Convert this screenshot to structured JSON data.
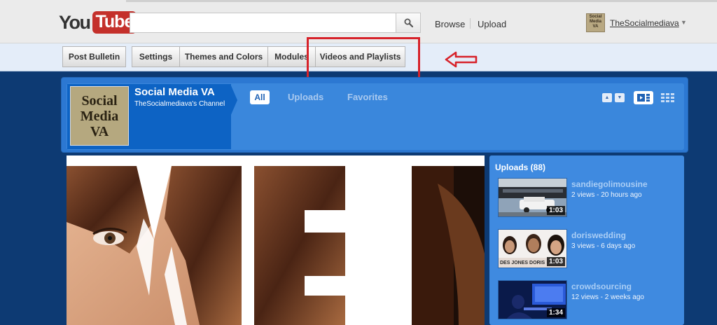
{
  "masthead": {
    "logo_you": "You",
    "logo_tube": "Tube",
    "search": {
      "value": "",
      "placeholder": ""
    },
    "nav": [
      {
        "label": "Browse"
      },
      {
        "label": "Upload"
      }
    ],
    "user": {
      "name": "TheSocialmediava",
      "avatar_text": "Social Media VA"
    }
  },
  "editor_bar": {
    "buttons": [
      {
        "label": "Post Bulletin"
      },
      {
        "label": "Settings"
      },
      {
        "label": "Themes and Colors"
      },
      {
        "label": "Modules"
      },
      {
        "label": "Videos and Playlists"
      }
    ],
    "highlight_color": "#d7222a"
  },
  "channel": {
    "logo_lines": [
      "Social",
      "Media",
      "VA"
    ],
    "title": "Social Media VA",
    "subtitle": "TheSocialmediava's Channel",
    "tabs": [
      {
        "label": "All",
        "active": true
      },
      {
        "label": "Uploads",
        "active": false
      },
      {
        "label": "Favorites",
        "active": false
      }
    ]
  },
  "uploads": {
    "title": "Uploads (88)",
    "videos": [
      {
        "title": "sandiegolimousine",
        "meta": "2 views - 20 hours ago",
        "duration": "1:03"
      },
      {
        "title": "doriswedding",
        "meta": "3 views - 6 days ago",
        "duration": "1:03",
        "thumb_caption": "DES JONES DORIS"
      },
      {
        "title": "crowdsourcing",
        "meta": "12 views - 2 weeks ago",
        "duration": "1:34"
      }
    ]
  },
  "colors": {
    "page_bg": "#0d3a73",
    "channel_blue": "#2c78d2",
    "identity_blue": "#0d63c4",
    "brand_red": "#c4302b"
  }
}
